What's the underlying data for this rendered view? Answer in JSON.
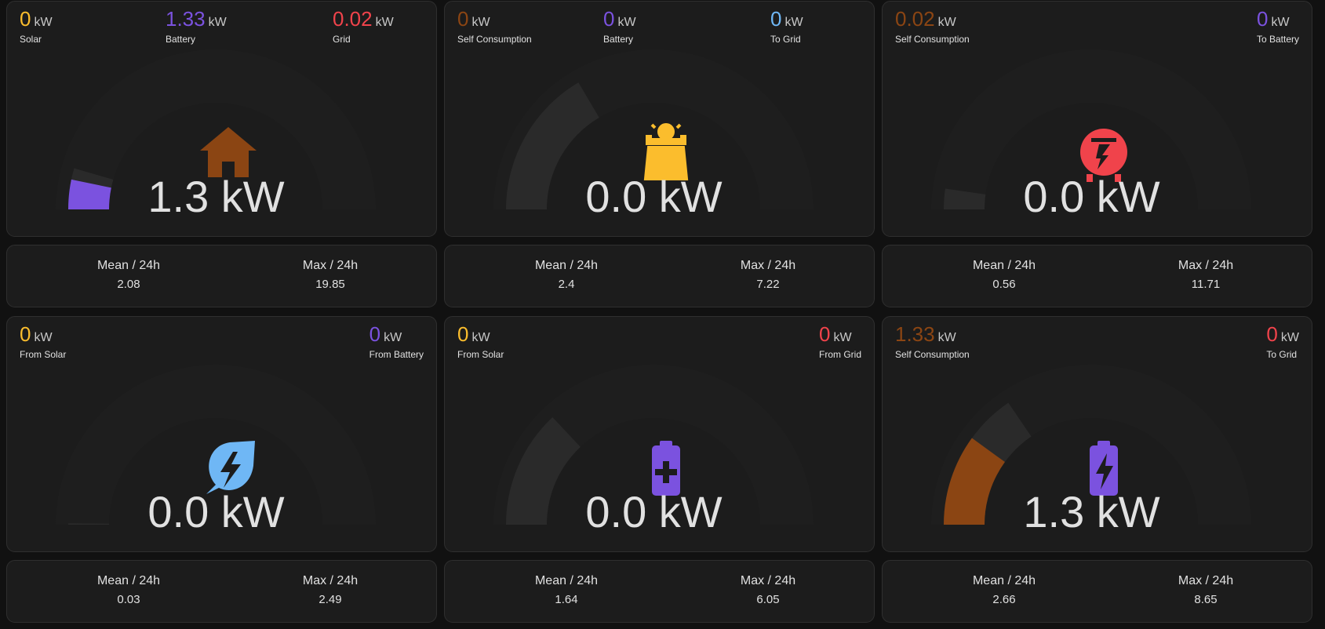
{
  "unit": "kW",
  "cards": [
    {
      "readings": [
        {
          "value": "0",
          "label": "Solar",
          "color": "#fbbd2d"
        },
        {
          "value": "1.33",
          "label": "Battery",
          "color": "#7b52df"
        },
        {
          "value": "0.02",
          "label": "Grid",
          "color": "#f0434b"
        }
      ],
      "main_value": "1.3 kW",
      "icon": "home-icon",
      "icon_color": "#8b4513",
      "gauge": {
        "fill_fraction": 0.065,
        "fill_color": "#7b52df",
        "stack": [
          {
            "color": "#7b52df",
            "fraction": 0.065
          }
        ],
        "extra_fraction": 0.09
      },
      "stats": {
        "mean_label": "Mean / 24h",
        "mean": "2.08",
        "max_label": "Max / 24h",
        "max": "19.85"
      }
    },
    {
      "readings": [
        {
          "value": "0",
          "label": "Self Consumption",
          "color": "#8b4513"
        },
        {
          "value": "0",
          "label": "Battery",
          "color": "#7b52df"
        },
        {
          "value": "0",
          "label": "To Grid",
          "color": "#6fb7f5"
        }
      ],
      "main_value": "0.0 kW",
      "icon": "solar-panel-icon",
      "icon_color": "#fbbd2d",
      "gauge": {
        "fill_fraction": 0,
        "fill_color": "#fbbd2d",
        "extra_fraction": 0.33
      },
      "stats": {
        "mean_label": "Mean / 24h",
        "mean": "2.4",
        "max_label": "Max / 24h",
        "max": "7.22"
      }
    },
    {
      "readings": [
        {
          "value": "0.02",
          "label": "Self Consumption",
          "color": "#8b4513"
        },
        {
          "value": "0",
          "label": "To Battery",
          "color": "#7b52df"
        }
      ],
      "main_value": "0.0 kW",
      "icon": "transmission-tower-icon",
      "icon_color": "#f0434b",
      "gauge": {
        "fill_fraction": 0,
        "fill_color": "#8b4513",
        "extra_fraction": 0.045
      },
      "stats": {
        "mean_label": "Mean / 24h",
        "mean": "0.56",
        "max_label": "Max / 24h",
        "max": "11.71"
      }
    },
    {
      "readings": [
        {
          "value": "0",
          "label": "From Solar",
          "color": "#fbbd2d"
        },
        {
          "value": "0",
          "label": "From Battery",
          "color": "#7b52df"
        }
      ],
      "main_value": "0.0 kW",
      "icon": "leaf-bolt-icon",
      "icon_color": "#6fb7f5",
      "gauge": {
        "fill_fraction": 0,
        "fill_color": "#6fb7f5",
        "extra_fraction": 0.003
      },
      "stats": {
        "mean_label": "Mean / 24h",
        "mean": "0.03",
        "max_label": "Max / 24h",
        "max": "2.49"
      }
    },
    {
      "readings": [
        {
          "value": "0",
          "label": "From Solar",
          "color": "#fbbd2d"
        },
        {
          "value": "0",
          "label": "From Grid",
          "color": "#f0434b"
        }
      ],
      "main_value": "0.0 kW",
      "icon": "battery-plus-icon",
      "icon_color": "#7b52df",
      "gauge": {
        "fill_fraction": 0,
        "fill_color": "#7b52df",
        "extra_fraction": 0.26
      },
      "stats": {
        "mean_label": "Mean / 24h",
        "mean": "1.64",
        "max_label": "Max / 24h",
        "max": "6.05"
      }
    },
    {
      "readings": [
        {
          "value": "1.33",
          "label": "Self Consumption",
          "color": "#8b4513"
        },
        {
          "value": "0",
          "label": "To Grid",
          "color": "#f0434b"
        }
      ],
      "main_value": "1.3 kW",
      "icon": "battery-bolt-icon",
      "icon_color": "#7b52df",
      "gauge": {
        "fill_fraction": 0.2,
        "fill_color": "#8b4513",
        "extra_fraction": 0.31
      },
      "stats": {
        "mean_label": "Mean / 24h",
        "mean": "2.66",
        "max_label": "Max / 24h",
        "max": "8.65"
      }
    }
  ]
}
